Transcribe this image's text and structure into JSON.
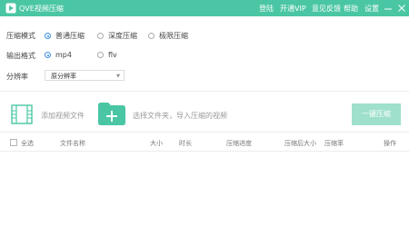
{
  "app": {
    "title": "QVE视频压缩",
    "nav": {
      "login": "登陆",
      "vip": "开通VIP",
      "feedback": "意见反馈",
      "help": "帮助",
      "settings": "设置"
    }
  },
  "options": {
    "mode": {
      "label": "压缩模式",
      "items": [
        "普通压缩",
        "深度压缩",
        "极限压缩"
      ],
      "selected": "普通压缩"
    },
    "format": {
      "label": "输出格式",
      "items": [
        "mp4",
        "flv"
      ],
      "selected": "mp4"
    },
    "resolution": {
      "label": "分辨率",
      "value": "原分辨率"
    }
  },
  "actions": {
    "add_video": "添加视频文件",
    "add_folder": "选择文件夹，导入压缩的视频",
    "compress_all": "一键压缩"
  },
  "table": {
    "select_all": "全选",
    "columns": [
      "文件名称",
      "大小",
      "时长",
      "压缩进度",
      "压缩后大小",
      "压缩率",
      "操作"
    ]
  },
  "colors": {
    "brand": "#4ac6a4",
    "button": "#9ee0cb",
    "radio": "#3a8ee6"
  }
}
